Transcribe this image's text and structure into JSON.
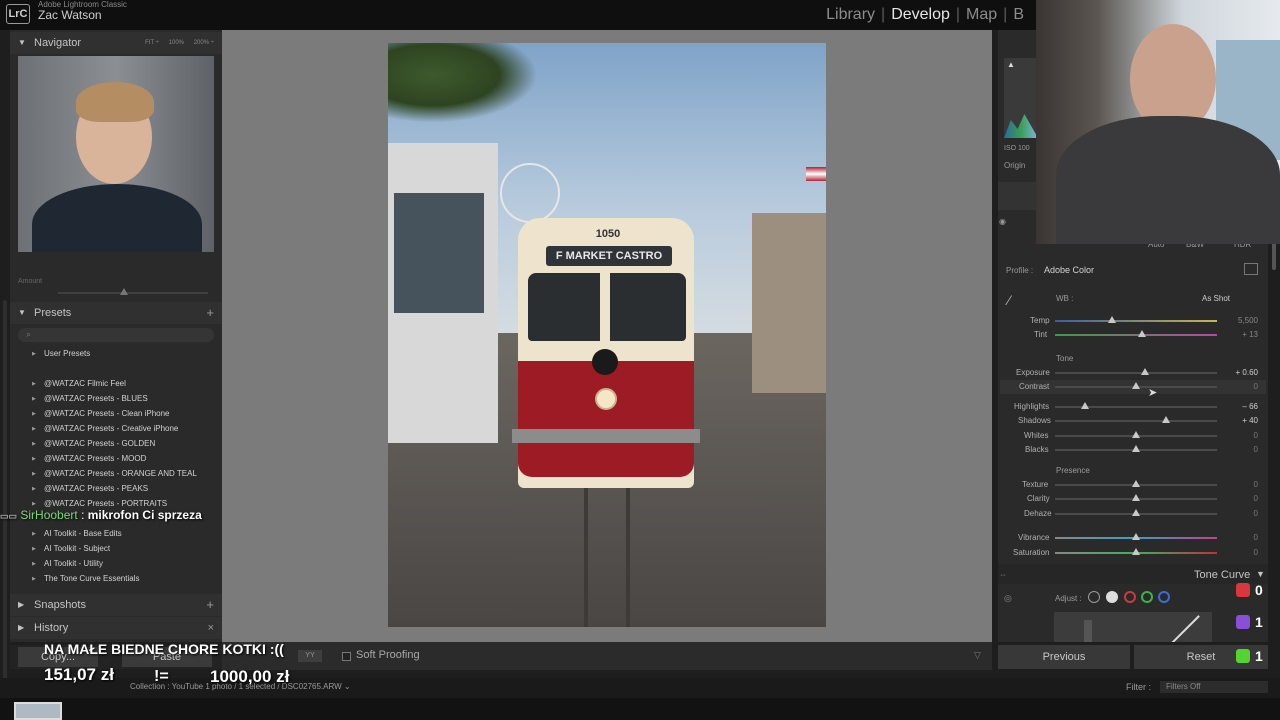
{
  "app": {
    "name": "Adobe Lightroom Classic",
    "user": "Zac Watson",
    "logo": "LrC"
  },
  "modules": [
    "Library",
    "Develop",
    "Map",
    "B"
  ],
  "active_module": "Develop",
  "left": {
    "navigator_title": "Navigator",
    "zoom_options": [
      "FIT ÷",
      "100%",
      "200% ÷"
    ],
    "amount_label": "Amount",
    "presets_title": "Presets",
    "presets": [
      "User Presets",
      "@WATZAC Filmic Feel",
      "@WATZAC Presets - BLUES",
      "@WATZAC Presets - Clean iPhone",
      "@WATZAC Presets - Creative iPhone",
      "@WATZAC Presets - GOLDEN",
      "@WATZAC Presets - MOOD",
      "@WATZAC Presets - ORANGE AND TEAL",
      "@WATZAC Presets - PEAKS",
      "@WATZAC Presets - PORTRAITS",
      "AI Toolkit - Base Edits",
      "AI Toolkit - Subject",
      "AI Toolkit - Utility",
      "The Tone Curve Essentials"
    ],
    "snapshots_title": "Snapshots",
    "history_title": "History",
    "copy_label": "Copy...",
    "paste_label": "Paste"
  },
  "toolbar": {
    "soft_proofing": "Soft Proofing"
  },
  "filmstrip": {
    "path": "Collection : YouTube   1 photo / 1 selected / DSC02765.ARW ⌄",
    "filter_label": "Filter :",
    "filter_value": "Filters Off"
  },
  "right": {
    "iso": "ISO 100",
    "original": "Origin",
    "auto_row": [
      "Auto",
      "B&W",
      "HDR"
    ],
    "profile_label": "Profile :",
    "profile_value": "Adobe Color",
    "wb_label": "WB :",
    "wb_value": "As Shot",
    "temp_label": "Temp",
    "temp_value": "5,500",
    "tint_label": "Tint",
    "tint_value": "+ 13",
    "tone_section": "Tone",
    "exposure_label": "Exposure",
    "exposure_value": "+ 0.60",
    "contrast_label": "Contrast",
    "contrast_value": "0",
    "highlights_label": "Highlights",
    "highlights_value": "– 66",
    "shadows_label": "Shadows",
    "shadows_value": "+ 40",
    "whites_label": "Whites",
    "whites_value": "0",
    "blacks_label": "Blacks",
    "blacks_value": "0",
    "presence_section": "Presence",
    "texture_label": "Texture",
    "texture_value": "0",
    "clarity_label": "Clarity",
    "clarity_value": "0",
    "dehaze_label": "Dehaze",
    "dehaze_value": "0",
    "vibrance_label": "Vibrance",
    "vibrance_value": "0",
    "saturation_label": "Saturation",
    "saturation_value": "0",
    "tone_curve_title": "Tone Curve",
    "adjust_label": "Adjust :",
    "previous_label": "Previous",
    "reset_label": "Reset"
  },
  "photo": {
    "tram_number": "1050",
    "tram_sign": "F MARKET   CASTRO"
  },
  "stream": {
    "chat_user": "SirHoobert",
    "chat_message": "mikrofon Ci sprzeza",
    "donation_message": "NA MAŁE BIEDNE CHORE KOTKI :((",
    "donation_amount": "151,07 zł",
    "donation_neq": "!=",
    "donation_goal": "1000,00 zł",
    "stats": [
      "0",
      "1",
      "1"
    ]
  }
}
